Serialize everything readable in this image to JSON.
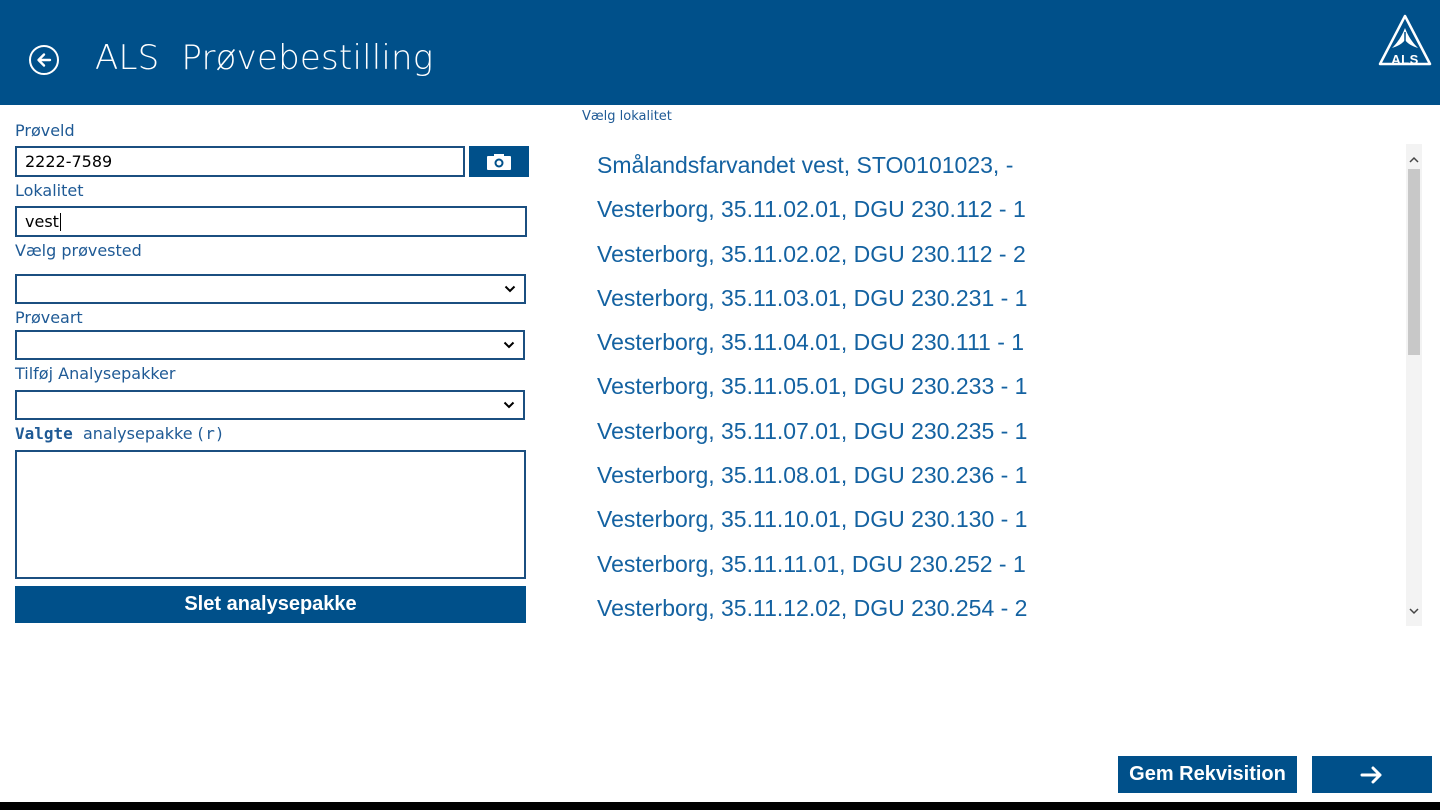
{
  "header": {
    "title": "ALS  Prøvebestilling",
    "logo_text": "ALS",
    "color": "#00508a"
  },
  "form": {
    "proeveid_label": "Prøveld",
    "proeveid_value": "2222-7589",
    "lokalitet_label": "Lokalitet",
    "lokalitet_value": "vest",
    "provested_label": "Vælg prøvested",
    "provested_value": "",
    "proveart_label": "Prøveart",
    "proveart_value": "",
    "analysepakker_label": "Tilføj Analysepakker",
    "analysepakker_value": "",
    "valgte_label_a": "Valgte",
    "valgte_label_b": "analysepakke",
    "valgte_label_c": "(r)",
    "delete_button": "Slet analysepakke"
  },
  "locations": {
    "header": "Vælg  lokalitet",
    "items": [
      "Smålandsfarvandet vest, STO0101023,  -",
      "Vesterborg, 35.11.02.01, DGU 230.112 - 1",
      "Vesterborg, 35.11.02.02, DGU 230.112 - 2",
      "Vesterborg, 35.11.03.01, DGU 230.231 - 1",
      "Vesterborg, 35.11.04.01, DGU 230.111 - 1",
      "Vesterborg, 35.11.05.01, DGU 230.233 - 1",
      "Vesterborg, 35.11.07.01, DGU 230.235 - 1",
      "Vesterborg, 35.11.08.01, DGU 230.236 - 1",
      "Vesterborg, 35.11.10.01, DGU 230.130 - 1",
      "Vesterborg, 35.11.11.01, DGU 230.252 - 1",
      "Vesterborg, 35.11.12.02, DGU 230.254 - 2"
    ]
  },
  "footer": {
    "save_button": "Gem Rekvisition"
  },
  "icons": {
    "back": "back-arrow-circle-icon",
    "camera": "camera-icon",
    "next": "arrow-right-icon",
    "logo": "als-logo-icon"
  }
}
